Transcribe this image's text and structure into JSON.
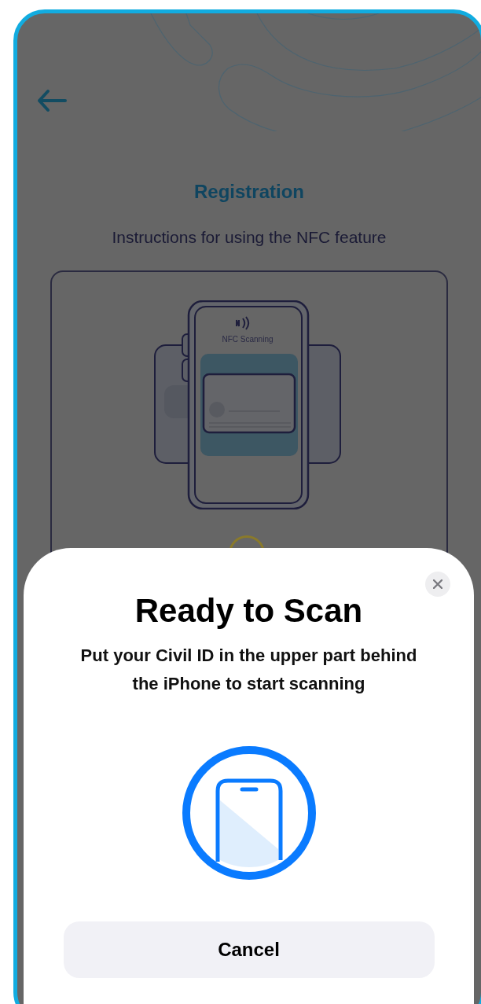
{
  "header": {
    "title": "Registration",
    "subtitle": "Instructions for using the NFC feature"
  },
  "illustration": {
    "caption": "NFC Scanning"
  },
  "scan_sheet": {
    "title": "Ready to Scan",
    "message": "Put your Civil ID in the upper part behind the iPhone to start scanning",
    "button": "Cancel"
  }
}
